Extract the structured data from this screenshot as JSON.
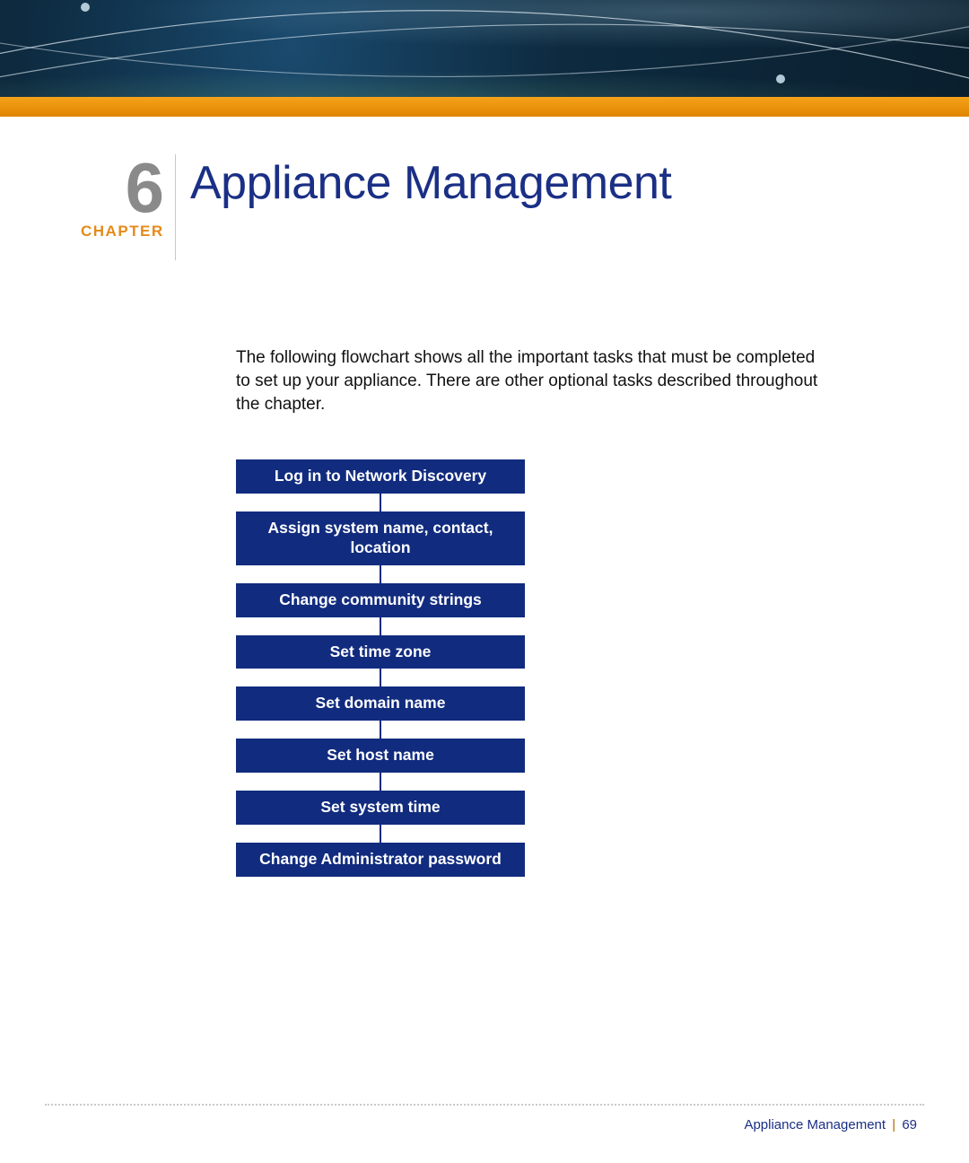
{
  "chapter": {
    "number": "6",
    "label": "CHAPTER",
    "title": "Appliance Management"
  },
  "intro_text": "The following flowchart shows all the important tasks that must be completed to set up your appliance. There are other optional tasks described throughout the chapter.",
  "flowchart": {
    "steps": [
      "Log in to Network Discovery",
      "Assign system name, contact, location",
      "Change community strings",
      "Set time zone",
      "Set domain name",
      "Set host name",
      "Set system time",
      "Change Administrator password"
    ]
  },
  "footer": {
    "section": "Appliance Management",
    "separator": "|",
    "page": "69"
  },
  "colors": {
    "title_blue": "#1a2f85",
    "step_blue": "#112b7e",
    "accent_orange": "#e58a1a"
  }
}
